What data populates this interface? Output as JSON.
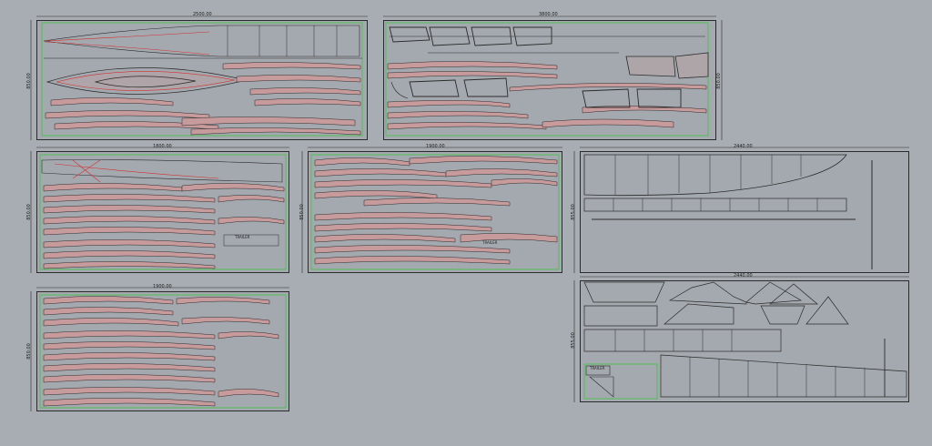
{
  "sheets": [
    {
      "id": "sheet-1",
      "width_label": "2500.00",
      "height_label": "850.00"
    },
    {
      "id": "sheet-2",
      "width_label": "3800.00",
      "height_label": "850.00"
    },
    {
      "id": "sheet-3",
      "width_label": "1800.00",
      "height_label": "850.00"
    },
    {
      "id": "sheet-4",
      "width_label": "1900.00",
      "height_label": "850.00"
    },
    {
      "id": "sheet-5",
      "width_label": "2440.00",
      "height_label": "855.00"
    },
    {
      "id": "sheet-6",
      "width_label": "1900.00",
      "height_label": "850.00"
    },
    {
      "id": "sheet-7",
      "width_label": "2440.00",
      "height_label": "855.00"
    }
  ],
  "part_labels": [
    {
      "text": "TRAILER"
    },
    {
      "text": "TRAILER"
    },
    {
      "text": "TRAILER"
    }
  ],
  "colors": {
    "background": "#a7adb2",
    "outline": "#2b2b2b",
    "nest_boundary": "#3ec43e",
    "part_fill": "#c79a9c",
    "cut_line": "#d33030"
  }
}
